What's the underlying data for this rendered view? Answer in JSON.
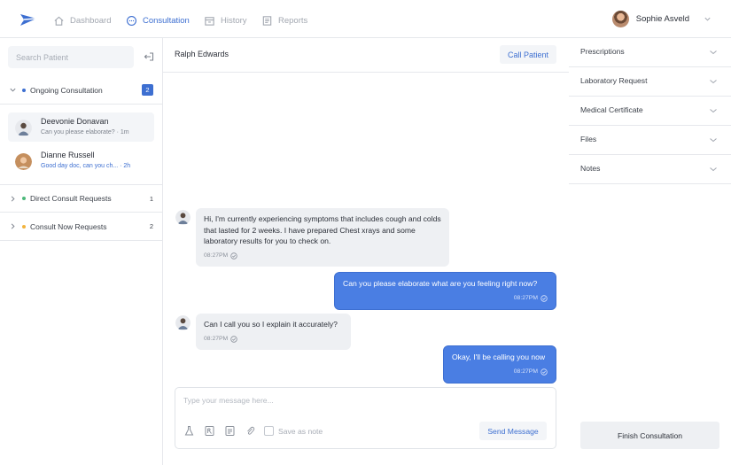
{
  "nav": {
    "items": [
      {
        "label": "Dashboard",
        "icon": "home-icon",
        "active": false
      },
      {
        "label": "Consultation",
        "icon": "chat-bubble-icon",
        "active": true
      },
      {
        "label": "History",
        "icon": "archive-box-icon",
        "active": false
      },
      {
        "label": "Reports",
        "icon": "document-icon",
        "active": false
      }
    ],
    "user_name": "Sophie Asveld"
  },
  "left": {
    "search_placeholder": "Search Patient",
    "groups": {
      "ongoing": {
        "label": "Ongoing Consultation",
        "count": "2",
        "dot_color": "#3d6fd1"
      },
      "direct": {
        "label": "Direct Consult Requests",
        "count": "1",
        "dot_color": "#4cb87a"
      },
      "now": {
        "label": "Consult Now Requests",
        "count": "2",
        "dot_color": "#f2b33d"
      }
    },
    "patients": [
      {
        "name": "Deevonie Donavan",
        "preview": "Can you please elaborate?",
        "time": "· 1m",
        "unread": false
      },
      {
        "name": "Dianne Russell",
        "preview": "Good day doc, can you ch...",
        "time": "· 2h",
        "unread": true
      }
    ]
  },
  "chat": {
    "patient_name": "Ralph Edwards",
    "call_label": "Call Patient",
    "messages": [
      {
        "direction": "in",
        "text": "Hi, I'm currently experiencing symptoms that includes cough and colds that lasted for 2 weeks. I have prepared Chest xrays and some laboratory results for you to check on.",
        "time": "08:27PM"
      },
      {
        "direction": "out",
        "text": "Can you please elaborate what are you feeling right now?",
        "time": "08:27PM"
      },
      {
        "direction": "in",
        "text": "Can I call you so I explain it accurately?",
        "time": "08:27PM"
      },
      {
        "direction": "out",
        "text": "Okay, I'll be calling you now",
        "time": "08:27PM"
      }
    ],
    "composer": {
      "placeholder": "Type your message here...",
      "note_label": "Save as note",
      "send_label": "Send Message"
    }
  },
  "right": {
    "sections": [
      "Prescriptions",
      "Laboratory Request",
      "Medical Certificate",
      "Files",
      "Notes"
    ],
    "finish_label": "Finish Consultation"
  },
  "colors": {
    "accent": "#3d6fd1",
    "outgoing_bubble": "#4a7ee3",
    "incoming_bubble": "#eef0f3"
  }
}
